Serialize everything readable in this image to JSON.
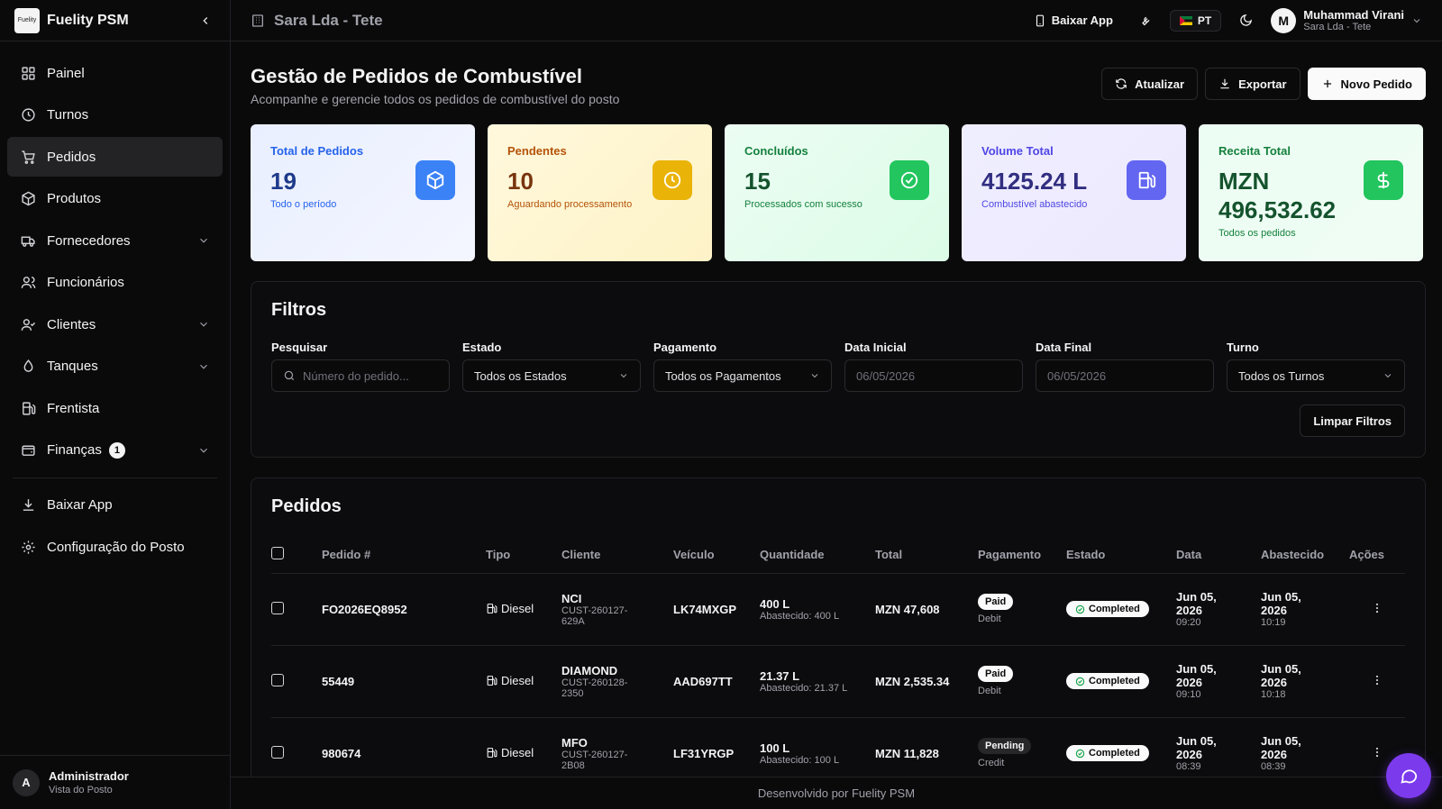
{
  "brand": {
    "name": "Fuelity PSM",
    "logo_text": "Fuelity"
  },
  "sidebar": {
    "items": [
      {
        "label": "Painel",
        "icon": "dashboard-icon"
      },
      {
        "label": "Turnos",
        "icon": "clock-icon"
      },
      {
        "label": "Pedidos",
        "icon": "cart-icon",
        "active": true
      },
      {
        "label": "Produtos",
        "icon": "box-icon"
      },
      {
        "label": "Fornecedores",
        "icon": "truck-icon",
        "expandable": true
      },
      {
        "label": "Funcionários",
        "icon": "users-icon"
      },
      {
        "label": "Clientes",
        "icon": "user-check-icon",
        "expandable": true
      },
      {
        "label": "Tanques",
        "icon": "droplet-icon",
        "expandable": true
      },
      {
        "label": "Frentista",
        "icon": "fuel-icon"
      },
      {
        "label": "Finanças",
        "icon": "wallet-icon",
        "expandable": true,
        "badge": "1"
      }
    ],
    "bottom_items": [
      {
        "label": "Baixar App",
        "icon": "download-icon"
      },
      {
        "label": "Configuração do Posto",
        "icon": "gear-icon"
      }
    ],
    "user": {
      "initial": "A",
      "name": "Administrador",
      "role": "Vista do Posto"
    }
  },
  "topbar": {
    "station": "Sara Lda - Tete",
    "download_app": "Baixar App",
    "language": "PT",
    "user_initial": "M",
    "user_name": "Muhammad Virani",
    "user_station": "Sara Lda - Tete"
  },
  "page": {
    "title": "Gestão de Pedidos de Combustível",
    "subtitle": "Acompanhe e gerencie todos os pedidos de combustível do posto",
    "actions": {
      "refresh": "Atualizar",
      "export": "Exportar",
      "new": "Novo Pedido"
    }
  },
  "stats": [
    {
      "label": "Total de Pedidos",
      "value": "19",
      "desc": "Todo o período"
    },
    {
      "label": "Pendentes",
      "value": "10",
      "desc": "Aguardando processamento"
    },
    {
      "label": "Concluídos",
      "value": "15",
      "desc": "Processados com sucesso"
    },
    {
      "label": "Volume Total",
      "value": "4125.24 L",
      "desc": "Combustível abastecido"
    },
    {
      "label": "Receita Total",
      "value": "MZN 496,532.62",
      "desc": "Todos os pedidos"
    }
  ],
  "filters": {
    "title": "Filtros",
    "search_label": "Pesquisar",
    "search_placeholder": "Número do pedido...",
    "estado_label": "Estado",
    "estado_value": "Todos os Estados",
    "pagamento_label": "Pagamento",
    "pagamento_value": "Todos os Pagamentos",
    "data_inicial_label": "Data Inicial",
    "data_inicial_value": "06/05/2026",
    "data_final_label": "Data Final",
    "data_final_value": "06/05/2026",
    "turno_label": "Turno",
    "turno_value": "Todos os Turnos",
    "clear": "Limpar Filtros"
  },
  "orders": {
    "title": "Pedidos",
    "columns": [
      "Pedido #",
      "Tipo",
      "Cliente",
      "Veículo",
      "Quantidade",
      "Total",
      "Pagamento",
      "Estado",
      "Data",
      "Abastecido",
      "Ações"
    ],
    "rows": [
      {
        "id": "FO2026EQ8952",
        "tipo": "Diesel",
        "cliente": "NCI",
        "cliente_code": "CUST-260127-629A",
        "veiculo": "LK74MXGP",
        "qty": "400 L",
        "qty_sub": "Abastecido: 400 L",
        "total": "MZN 47,608",
        "pay_status": "Paid",
        "pay_method": "Debit",
        "estado": "Completed",
        "data": "Jun 05, 2026",
        "data_time": "09:20",
        "abast": "Jun 05, 2026",
        "abast_time": "10:19"
      },
      {
        "id": "55449",
        "tipo": "Diesel",
        "cliente": "DIAMOND",
        "cliente_code": "CUST-260128-2350",
        "veiculo": "AAD697TT",
        "qty": "21.37 L",
        "qty_sub": "Abastecido: 21.37 L",
        "total": "MZN 2,535.34",
        "pay_status": "Paid",
        "pay_method": "Debit",
        "estado": "Completed",
        "data": "Jun 05, 2026",
        "data_time": "09:10",
        "abast": "Jun 05, 2026",
        "abast_time": "10:18"
      },
      {
        "id": "980674",
        "tipo": "Diesel",
        "cliente": "MFO",
        "cliente_code": "CUST-260127-2B08",
        "veiculo": "LF31YRGP",
        "qty": "100 L",
        "qty_sub": "Abastecido: 100 L",
        "total": "MZN 11,828",
        "pay_status": "Pending",
        "pay_method": "Credit",
        "estado": "Completed",
        "data": "Jun 05, 2026",
        "data_time": "08:39",
        "abast": "Jun 05, 2026",
        "abast_time": "08:39"
      }
    ]
  },
  "footer": {
    "text": "Desenvolvido por Fuelity PSM"
  },
  "colors": {
    "accent": "#7c3aed",
    "blue": "#3b82f6",
    "yellow": "#eab308",
    "green": "#22c55e",
    "indigo": "#6366f1"
  }
}
